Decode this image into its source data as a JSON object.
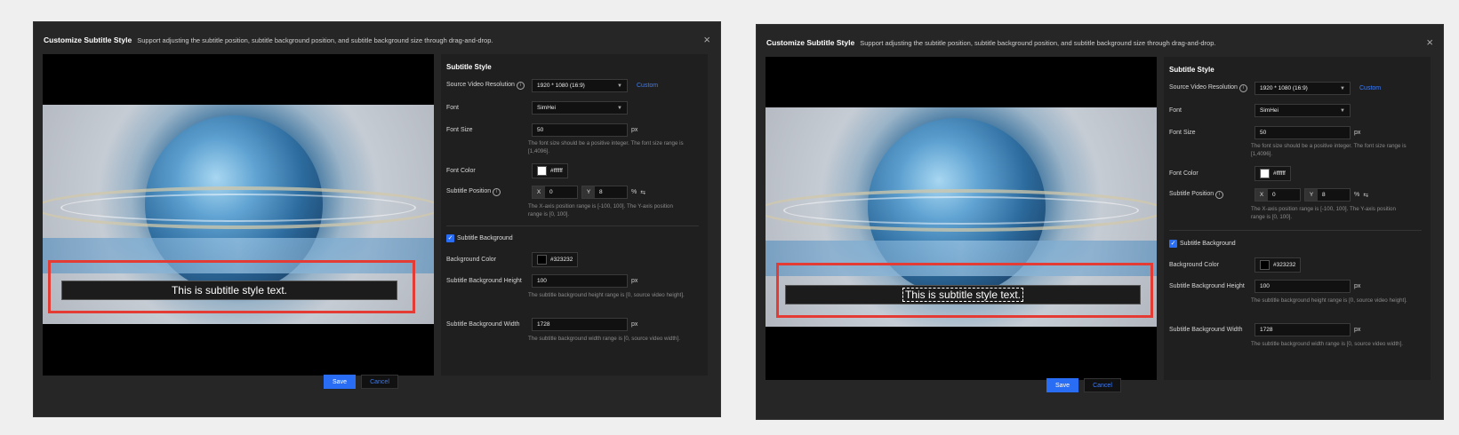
{
  "dialog": {
    "title": "Customize Subtitle Style",
    "description": "Support adjusting the subtitle position, subtitle background position, and subtitle background size through drag-and-drop.",
    "close_glyph": "×"
  },
  "preview": {
    "subtitle_text": "This is subtitle style text."
  },
  "panel": {
    "section_title": "Subtitle Style",
    "resolution": {
      "label": "Source Video Resolution",
      "value": "1920 * 1080 (16:9)",
      "custom_link": "Custom"
    },
    "font": {
      "label": "Font",
      "value": "SimHei"
    },
    "font_size": {
      "label": "Font Size",
      "value": "50",
      "unit": "px",
      "hint": "The font size should be a positive integer. The font size range is [1,4096]."
    },
    "font_color": {
      "label": "Font Color",
      "value": "#ffffff"
    },
    "subtitle_position": {
      "label": "Subtitle Position",
      "x_tag": "X",
      "x_value": "0",
      "y_tag": "Y",
      "y_value": "8",
      "unit": "%",
      "hint": "The X-axis position range is [-100, 100]. The Y-axis position range is [0, 100]."
    },
    "background_toggle": {
      "label": "Subtitle Background",
      "checked": true
    },
    "background_color": {
      "label": "Background Color",
      "value": "#323232"
    },
    "background_height": {
      "label": "Subtitle Background Height",
      "value": "100",
      "unit": "px",
      "hint": "The subtitle background height range is [0, source video height]."
    },
    "background_width": {
      "label": "Subtitle Background Width",
      "value": "1728",
      "unit": "px",
      "hint": "The subtitle background width range is [0, source video width]."
    }
  },
  "footer": {
    "save_label": "Save",
    "cancel_label": "Cancel"
  },
  "colors": {
    "accent": "#2a6df5",
    "highlight": "#e43b35",
    "dialog_bg": "#262626"
  },
  "icons": {
    "info": "info-icon",
    "swap": "swap-icon",
    "close": "close-icon",
    "chevron": "chevron-down-icon",
    "check": "check-icon"
  }
}
